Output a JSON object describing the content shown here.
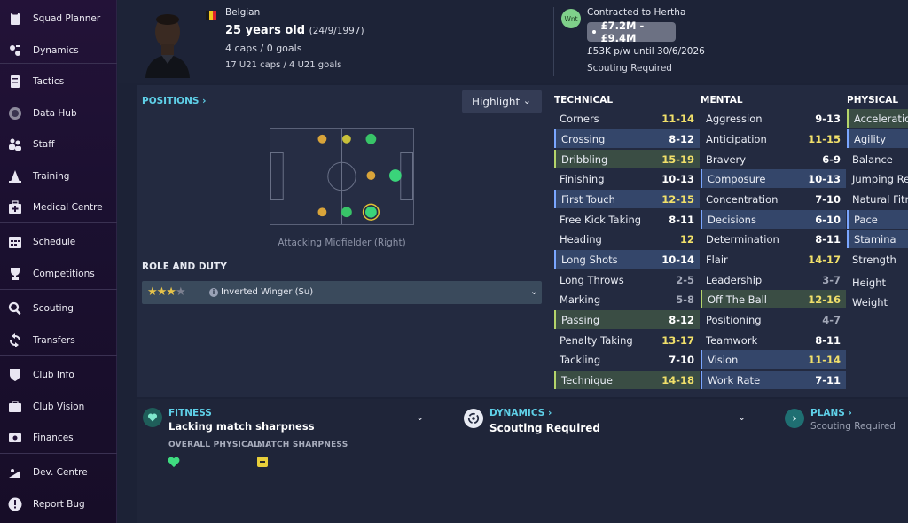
{
  "sidebar": {
    "items": [
      {
        "label": "Squad Planner",
        "icon": "clipboard-icon"
      },
      {
        "label": "Dynamics",
        "icon": "dynamics-icon"
      },
      {
        "label": "Tactics",
        "icon": "tactics-board-icon"
      },
      {
        "label": "Data Hub",
        "icon": "data-hub-icon"
      },
      {
        "label": "Staff",
        "icon": "staff-icon"
      },
      {
        "label": "Training",
        "icon": "training-cone-icon"
      },
      {
        "label": "Medical Centre",
        "icon": "medical-kit-icon"
      },
      {
        "label": "Schedule",
        "icon": "calendar-icon"
      },
      {
        "label": "Competitions",
        "icon": "trophy-icon"
      },
      {
        "label": "Scouting",
        "icon": "magnifier-icon"
      },
      {
        "label": "Transfers",
        "icon": "transfer-arrows-icon"
      },
      {
        "label": "Club Info",
        "icon": "shield-icon"
      },
      {
        "label": "Club Vision",
        "icon": "briefcase-icon"
      },
      {
        "label": "Finances",
        "icon": "money-icon"
      },
      {
        "label": "Dev. Centre",
        "icon": "dev-centre-icon"
      },
      {
        "label": "Report Bug",
        "icon": "alert-icon"
      }
    ]
  },
  "header": {
    "nationality": "Belgian",
    "age": "25 years old",
    "dob": "(24/9/1997)",
    "caps": "4 caps / 0 goals",
    "u21": "17 U21 caps / 4 U21 goals",
    "interest_badge": "Wnt",
    "contract_status": "Contracted to Hertha",
    "value_range": "£7.2M - £9.4M",
    "wage": "£53K p/w until 30/6/2026",
    "scouting": "Scouting Required"
  },
  "positions": {
    "title": "POSITIONS",
    "highlight_label": "Highlight",
    "caption": "Attacking Midfielder (Right)"
  },
  "role": {
    "title": "ROLE AND DUTY",
    "label": "Inverted Winger (Su)",
    "stars": 3.5
  },
  "attributes": {
    "technical_title": "TECHNICAL",
    "mental_title": "MENTAL",
    "physical_title": "PHYSICAL",
    "technical": [
      {
        "name": "Corners",
        "value": "11-14"
      },
      {
        "name": "Crossing",
        "value": "8-12"
      },
      {
        "name": "Dribbling",
        "value": "15-19"
      },
      {
        "name": "Finishing",
        "value": "10-13"
      },
      {
        "name": "First Touch",
        "value": "12-15"
      },
      {
        "name": "Free Kick Taking",
        "value": "8-11"
      },
      {
        "name": "Heading",
        "value": "12"
      },
      {
        "name": "Long Shots",
        "value": "10-14"
      },
      {
        "name": "Long Throws",
        "value": "2-5"
      },
      {
        "name": "Marking",
        "value": "5-8"
      },
      {
        "name": "Passing",
        "value": "8-12"
      },
      {
        "name": "Penalty Taking",
        "value": "13-17"
      },
      {
        "name": "Tackling",
        "value": "7-10"
      },
      {
        "name": "Technique",
        "value": "14-18"
      }
    ],
    "mental": [
      {
        "name": "Aggression",
        "value": "9-13"
      },
      {
        "name": "Anticipation",
        "value": "11-15"
      },
      {
        "name": "Bravery",
        "value": "6-9"
      },
      {
        "name": "Composure",
        "value": "10-13"
      },
      {
        "name": "Concentration",
        "value": "7-10"
      },
      {
        "name": "Decisions",
        "value": "6-10"
      },
      {
        "name": "Determination",
        "value": "8-11"
      },
      {
        "name": "Flair",
        "value": "14-17"
      },
      {
        "name": "Leadership",
        "value": "3-7"
      },
      {
        "name": "Off The Ball",
        "value": "12-16"
      },
      {
        "name": "Positioning",
        "value": "4-7"
      },
      {
        "name": "Teamwork",
        "value": "8-11"
      },
      {
        "name": "Vision",
        "value": "11-14"
      },
      {
        "name": "Work Rate",
        "value": "7-11"
      }
    ],
    "physical": [
      {
        "name": "Acceleration"
      },
      {
        "name": "Agility"
      },
      {
        "name": "Balance"
      },
      {
        "name": "Jumping Rea"
      },
      {
        "name": "Natural Fitne"
      },
      {
        "name": "Pace"
      },
      {
        "name": "Stamina"
      },
      {
        "name": "Strength"
      },
      {
        "name": "Height"
      },
      {
        "name": "Weight"
      }
    ]
  },
  "fitness": {
    "title": "FITNESS",
    "status": "Lacking match sharpness",
    "col1": "OVERALL PHYSICAL...",
    "col2": "MATCH SHARPNESS"
  },
  "dynamics": {
    "title": "DYNAMICS",
    "status": "Scouting Required"
  },
  "plans": {
    "title": "PLANS",
    "status": "Scouting Required"
  },
  "colors": {
    "accent_cyan": "#5fd0e8",
    "yellow_value": "#f1e06a",
    "green_position": "#3ad47a",
    "natural_position": "#d9a43a"
  }
}
